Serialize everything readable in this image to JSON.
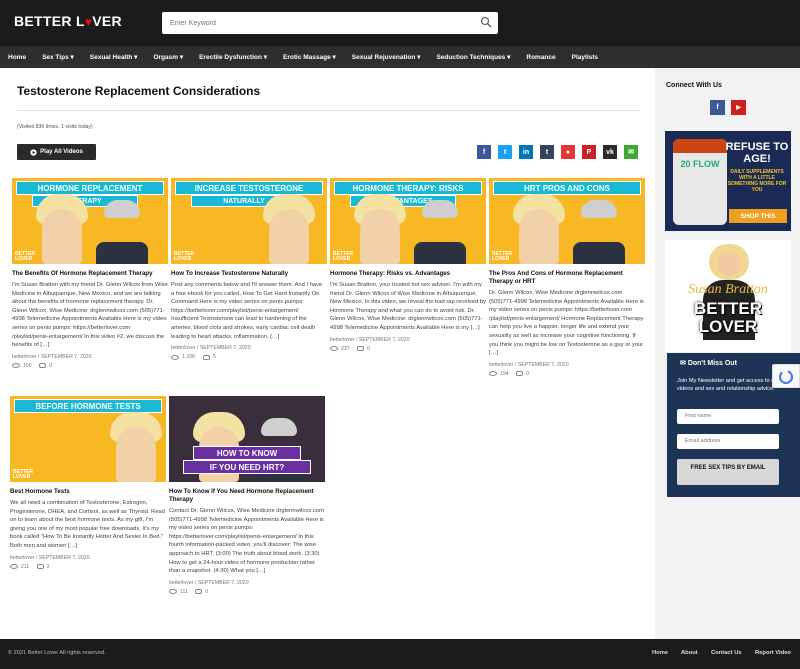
{
  "header": {
    "logo_left": "BETTER L",
    "logo_heart": "♥",
    "logo_right": "VER",
    "search_placeholder": "Enter Keyword"
  },
  "nav": [
    "Home",
    "Sex Tips ▾",
    "Sexual Health ▾",
    "Orgasm ▾",
    "Erectile Dysfunction ▾",
    "Erotic Massage ▾",
    "Sexual Rejuvenation ▾",
    "Seduction Techniques ▾",
    "Romance",
    "Playlists"
  ],
  "page": {
    "title": "Testosterone Replacement Considerations",
    "visits": "(Visited 836 times, 1 visits today)",
    "play_all": "Play All Videos"
  },
  "share_icons": [
    {
      "name": "facebook-share",
      "glyph": "f",
      "color": "#3b5998"
    },
    {
      "name": "twitter-share",
      "glyph": "t",
      "color": "#1da1f2"
    },
    {
      "name": "linkedin-share",
      "glyph": "in",
      "color": "#0077b5"
    },
    {
      "name": "tumblr-share",
      "glyph": "t",
      "color": "#35465c"
    },
    {
      "name": "reddit-share",
      "glyph": "●",
      "color": "#e4353a"
    },
    {
      "name": "pinterest-share",
      "glyph": "P",
      "color": "#cb2027"
    },
    {
      "name": "vk-share",
      "glyph": "vk",
      "color": "#2b2b2b"
    },
    {
      "name": "email-share",
      "glyph": "✉",
      "color": "#3aaa35"
    }
  ],
  "cards": [
    {
      "banner": "HORMONE REPLACEMENT",
      "banner2": "THERAPY",
      "title": "The Benefits Of Hormone Replacement Therapy",
      "excerpt": "I'm Susan Bratton with my friend Dr. Glenn Wilcox from Wise Medicine in Albuquerque, New Mexico, and we are talking about the benefits of hormone replacement therapy. Dr. Glenn Wilcox, Wise Medicine: drglennwilcox.com (505)771-4998 Telemedicine Appointments Available Here is my video series on penis pumps: https://betterlover.com /playlist/penis-enlargement/ In this video #2, we discuss the benefits of […]",
      "meta": "betterlover  /  SEPTEMBER 7, 2020",
      "views": "100",
      "comments": "0"
    },
    {
      "banner": "INCREASE TESTOSTERONE",
      "banner2": "NATURALLY",
      "title": "How To Increase Testosterone Naturally",
      "excerpt": "Post any comments below and I'll answer them. And I have a free ebook for you called, How To Get Hard Instantly On Command Here is my video series on penis pumps: https://betterlover.com/playlist/penis-enlargement/ Insufficient Testosterone can lead to hardening of the arteries, blood clots and strokes, early cardiac cell death leading to heart attacks, inflammation, […]",
      "meta": "betterlover  /  SEPTEMBER 7, 2020",
      "views": "1.20K",
      "comments": "5"
    },
    {
      "banner": "HORMONE THERAPY: RISKS",
      "banner2": "VS ADVANTAGES",
      "title": "Hormone Therapy: Risks vs. Advantages",
      "excerpt": "I'm Susan Bratton, your trusted hot sex adviser. I'm with my friend Dr. Glenn Wilcox of Wise Medicine in Albuquerque, New Mexico. In this video, we reveal the bad rap received by Hormone Therapy and what you can do to avoid risk. Dr. Glenn Wilcox, Wise Medicine: drglennwilcox.com (505)771-4998 Telemedicine Appointments Available Here is my […]",
      "meta": "betterlover  /  SEPTEMBER 7, 2020",
      "views": "237",
      "comments": "0"
    },
    {
      "banner": "HRT PROS AND CONS",
      "banner2": "",
      "title": "The Pros And Cons of Hormone Replacement Therapy or HRT",
      "excerpt": "Dr. Glenn Wilcox, Wise Medicine drglennwilcox.com (505)771-4998 Telemedicine Appointments Available Here is my video series on penis pumps: https://betterlover.com /playlist/penis-enlargement/ Hormone Replacement Therapy can help you live a happier, longer life and extend your sexuality as well as increase your cognitive functioning. If you think you might be low on Testosterone as a guy or your […]",
      "meta": "betterlover  /  SEPTEMBER 7, 2020",
      "views": "194",
      "comments": "0"
    },
    {
      "banner": "BEFORE HORMONE TESTS",
      "banner2": "",
      "title": "Best Hormone Tests",
      "excerpt": "We all need a combination of Testosterone, Estrogen, Progesterone, DHEA, and Cortisol, as well as Thyroid. Read on to learn about the best hormone tests. As my gift, I'm giving you one of my most popular free downloads. It's my book called \"How To Be Instantly Hotter And Sexier In Bed.\" Both men and women […]",
      "meta": "betterlover  /  SEPTEMBER 7, 2020",
      "views": "211",
      "comments": "2"
    },
    {
      "banner": "HOW TO KNOW",
      "banner2": "IF YOU NEED HRT?",
      "title": "How To Know If You Need Hormone Replacement Therapy",
      "excerpt": "Contact Dr. Glenn Wilcox, Wise Medicine drglennwilcox.com (505)771-4998 Telemedicine Appointments Available Here is my video series on penis pumps: https://betterlover.com/playlist/penis-enlargement/ In this fourth information-packed video, you'll discover: The wise approach to HRT. (3:00) The truth about blood work. (3:30) How to get a 24-hour video of hormone production rather than a snapshot. (4:30) What you […]",
      "meta": "betterlover  /  SEPTEMBER 7, 2020",
      "views": "111",
      "comments": "0"
    }
  ],
  "sidebar": {
    "connect_title": "Connect With Us",
    "facebook_glyph": "f",
    "youtube_glyph": "▶",
    "ad_brand": "20 FLOW",
    "ad_headline": "REFUSE TO AGE!",
    "ad_sub": "DAILY SUPPLEMENTS WITH A LITTLE SOMETHING MORE FOR YOU",
    "ad_cta": "SHOP THIS",
    "brand_name_1": "Susan Bratton",
    "brand_name_2": "BETTER LOVER",
    "newsletter_title": "Don't Miss Out",
    "newsletter_desc": "Join My Newsletter and get access to new videos and sex and relationship advice.",
    "first_name_placeholder": "First name",
    "email_placeholder": "Email address",
    "submit_label": "FREE SEX TIPS BY EMAIL"
  },
  "footer": {
    "copyright": "© 2021 Better Lover All rights reserved.",
    "links": [
      "Home",
      "About",
      "Contact Us",
      "Report Video"
    ]
  },
  "colors": {
    "accent": "#f7b824",
    "dark": "#1b1b1b",
    "banner": "#19b8d4",
    "newsletter": "#1d3456"
  }
}
